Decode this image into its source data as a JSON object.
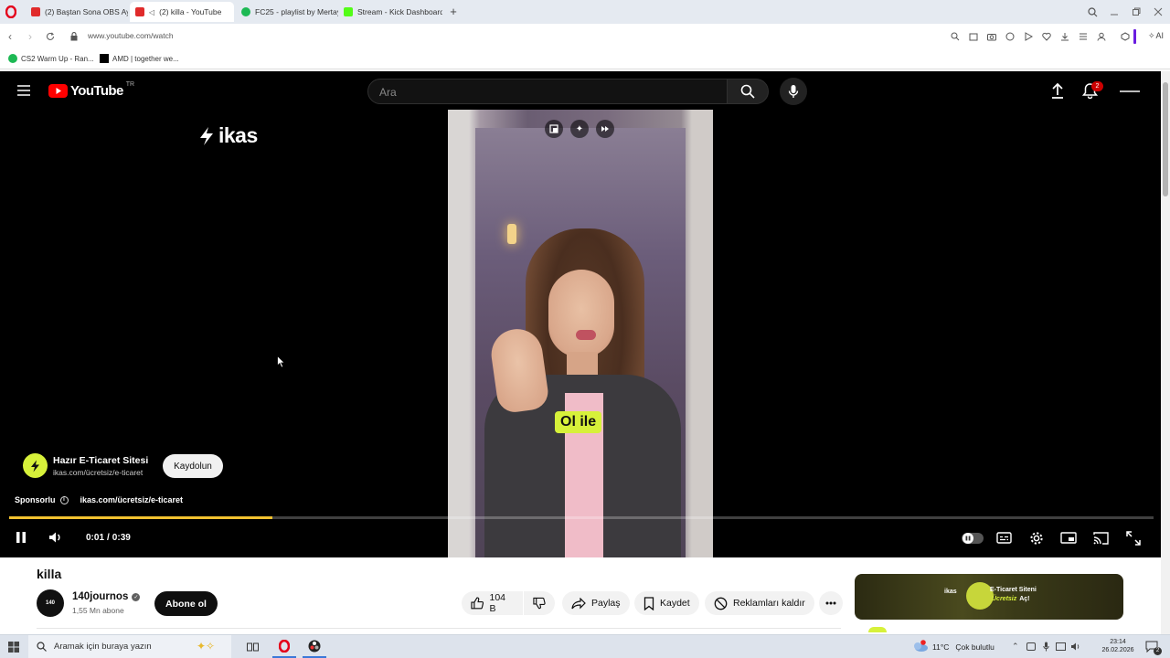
{
  "browser": {
    "tabs": [
      {
        "label": "(2) Baştan Sona OBS Ayarl",
        "color": "#e02b2b",
        "active": false
      },
      {
        "label": "(2) killa - YouTube",
        "color": "#e02b2b",
        "active": true
      },
      {
        "label": "FC25 - playlist by Mertay |",
        "color": "#1db954",
        "active": false
      },
      {
        "label": "Stream - Kick Dashboard",
        "color": "#53fc18",
        "active": false
      }
    ],
    "new_tab_label": "+",
    "url": "www.youtube.com/watch",
    "bookmarks": [
      {
        "label": "CS2 Warm Up - Ran...",
        "color": "#1db954"
      },
      {
        "label": "AMD | together we...",
        "color": "#000000"
      }
    ],
    "ai_label": "AI"
  },
  "youtube": {
    "logo_text": "YouTube",
    "region": "TR",
    "search_placeholder": "Ara",
    "notification_count": "2"
  },
  "player": {
    "ad_brand": "ikas",
    "ad_title": "Hazır E-Ticaret Sitesi",
    "ad_url": "ikas.com/ücretsiz/e-ticaret",
    "ad_cta": "Kaydolun",
    "sponsored_label": "Sponsorlu",
    "sponsored_url": "ikas.com/ücretsiz/e-ticaret",
    "caption": "Ol ile",
    "time_current": "0:01",
    "time_sep": "/",
    "time_total": "0:39",
    "progress_fraction": 0.23
  },
  "video": {
    "title": "killa",
    "channel_name": "140journos",
    "subscribers": "1,55 Mn abone",
    "subscribe_label": "Abone ol",
    "likes": "104 B",
    "share_label": "Paylaş",
    "save_label": "Kaydet",
    "remove_ads_label": "Reklamları kaldır",
    "side_ad_brand": "ikas",
    "side_ad_line1": "E-Ticaret Siteni",
    "side_ad_line2": "Ücretsiz",
    "side_ad_line3": "Aç!"
  },
  "taskbar": {
    "search_placeholder": "Aramak için buraya yazın",
    "weather_temp": "11°C",
    "weather_text": "Çok bulutlu",
    "time": "23:14",
    "date": "26.02.2026",
    "notif_count": "2"
  },
  "colors": {
    "yt_red": "#ff0000",
    "ikas_lime": "#d7f13a",
    "progress": "#f2c230",
    "subscribe_bg": "#0f0f0f"
  }
}
